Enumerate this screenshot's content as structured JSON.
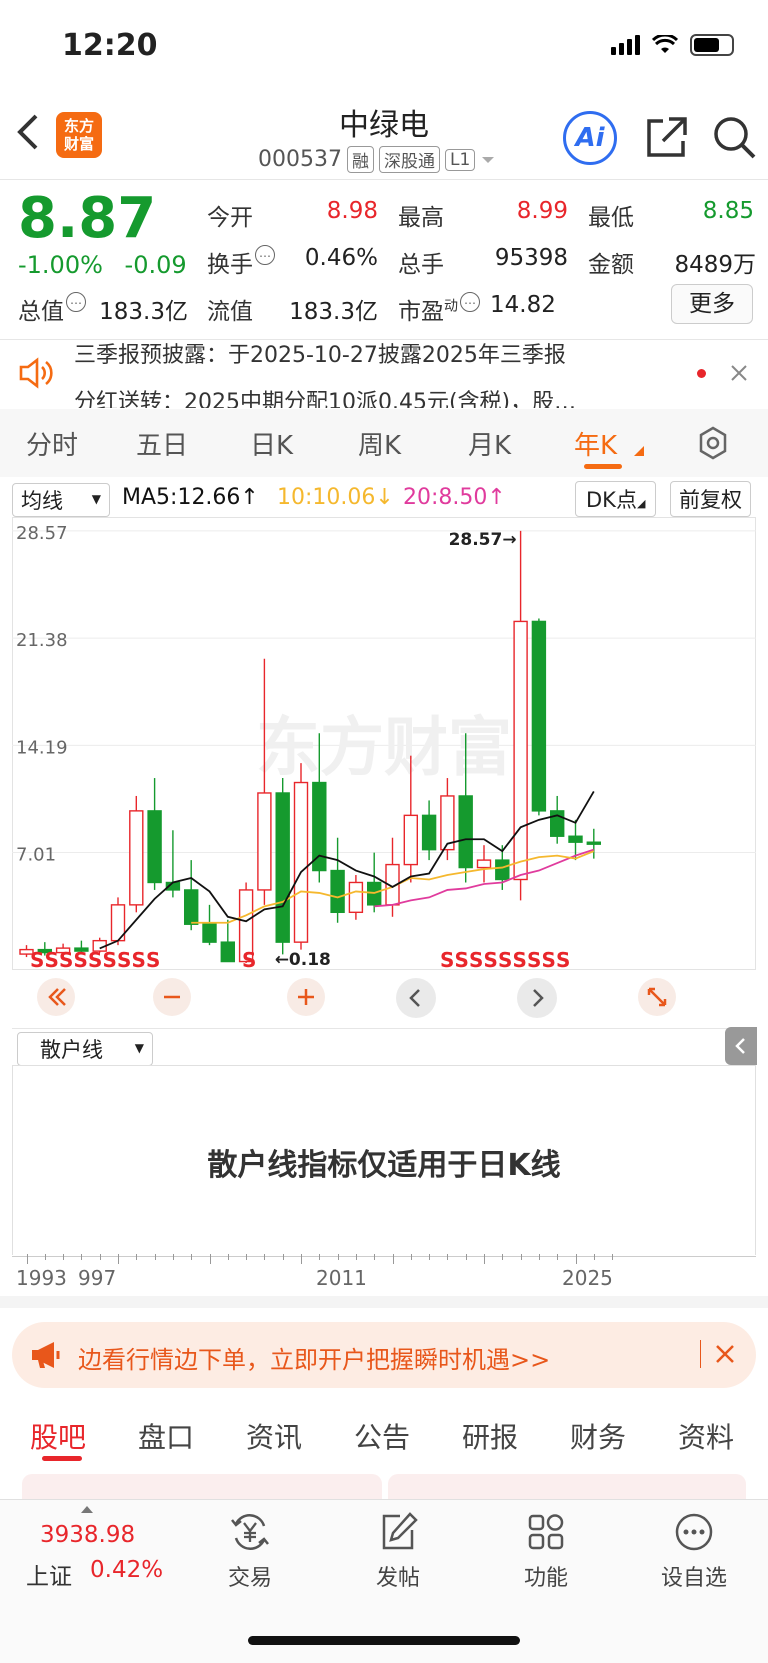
{
  "status_bar": {
    "time": "12:20"
  },
  "header": {
    "logo_text_1": "东方",
    "logo_text_2": "财富",
    "stock_name": "中绿电",
    "stock_code": "000537",
    "tags": [
      "融",
      "深股通",
      "L1"
    ],
    "ai_label": "Ai"
  },
  "quote": {
    "price": "8.87",
    "change_pct": "-1.00%",
    "change_abs": "-0.09",
    "open_label": "今开",
    "open": "8.98",
    "high_label": "最高",
    "high": "8.99",
    "low_label": "最低",
    "low": "8.85",
    "turnover_label": "换手",
    "turnover": "0.46%",
    "volume_label": "总手",
    "volume": "95398",
    "amount_label": "金额",
    "amount": "8489万",
    "mktcap_label": "总值",
    "mktcap": "183.3亿",
    "float_label": "流值",
    "float": "183.3亿",
    "pe_label": "市盈",
    "pe_sup": "动",
    "pe": "14.82",
    "more_label": "更多"
  },
  "notice": {
    "line1": "三季报预披露：于2025-10-27披露2025年三季报",
    "line2": "分红送转：2025中期分配10派0.45元(含税)，股…"
  },
  "kline_tabs": [
    "分时",
    "五日",
    "日K",
    "周K",
    "月K",
    "年K"
  ],
  "chart_toolbar": {
    "indicator": "均线",
    "ma5": "MA5:12.66",
    "ma10": "10:10.06",
    "ma20": "20:8.50",
    "dk": "DK点",
    "adjust": "前复权"
  },
  "chart_data": {
    "type": "candlestick",
    "y_ticks": [
      "28.57",
      "21.38",
      "14.19",
      "7.01"
    ],
    "y_tick_values": [
      28.57,
      21.38,
      14.19,
      7.01
    ],
    "ylim": [
      -0.8,
      29.5
    ],
    "max_label": "28.57→",
    "min_label": "←0.18",
    "x_labels": [
      "1993",
      "997",
      "2011",
      "2025"
    ],
    "watermark": "东方财富",
    "candles": [
      {
        "o": 0.2,
        "h": 0.8,
        "l": 0.0,
        "c": 0.5
      },
      {
        "o": 0.5,
        "h": 1.0,
        "l": 0.1,
        "c": 0.3
      },
      {
        "o": 0.3,
        "h": 0.9,
        "l": 0.0,
        "c": 0.6
      },
      {
        "o": 0.6,
        "h": 1.1,
        "l": 0.2,
        "c": 0.4
      },
      {
        "o": 0.4,
        "h": 1.3,
        "l": 0.3,
        "c": 1.1
      },
      {
        "o": 1.1,
        "h": 4.0,
        "l": 0.8,
        "c": 3.5
      },
      {
        "o": 3.5,
        "h": 10.8,
        "l": 3.0,
        "c": 9.8
      },
      {
        "o": 9.8,
        "h": 12.0,
        "l": 4.5,
        "c": 5.0
      },
      {
        "o": 5.0,
        "h": 8.5,
        "l": 4.0,
        "c": 4.5
      },
      {
        "o": 4.5,
        "h": 6.5,
        "l": 1.8,
        "c": 2.2
      },
      {
        "o": 2.2,
        "h": 3.5,
        "l": 0.8,
        "c": 1.0
      },
      {
        "o": 1.0,
        "h": 2.5,
        "l": 0.2,
        "c": -0.3
      },
      {
        "o": -0.3,
        "h": 5.0,
        "l": -0.4,
        "c": 4.5
      },
      {
        "o": 4.5,
        "h": 20.0,
        "l": 3.5,
        "c": 11.0
      },
      {
        "o": 11.0,
        "h": 12.0,
        "l": 0.18,
        "c": 1.0
      },
      {
        "o": 1.0,
        "h": 13.0,
        "l": 0.5,
        "c": 11.7
      },
      {
        "o": 11.7,
        "h": 15.0,
        "l": 5.0,
        "c": 5.8
      },
      {
        "o": 5.8,
        "h": 8.0,
        "l": 2.3,
        "c": 3.0
      },
      {
        "o": 3.0,
        "h": 5.5,
        "l": 2.5,
        "c": 5.0
      },
      {
        "o": 5.0,
        "h": 7.0,
        "l": 3.0,
        "c": 3.5
      },
      {
        "o": 3.5,
        "h": 8.0,
        "l": 2.7,
        "c": 6.2
      },
      {
        "o": 6.2,
        "h": 13.5,
        "l": 5.0,
        "c": 9.5
      },
      {
        "o": 9.5,
        "h": 10.5,
        "l": 6.5,
        "c": 7.2
      },
      {
        "o": 7.2,
        "h": 12.0,
        "l": 6.5,
        "c": 10.8
      },
      {
        "o": 10.8,
        "h": 15.0,
        "l": 5.0,
        "c": 6.0
      },
      {
        "o": 6.0,
        "h": 7.5,
        "l": 5.0,
        "c": 6.5
      },
      {
        "o": 6.5,
        "h": 7.5,
        "l": 4.5,
        "c": 5.2
      },
      {
        "o": 5.2,
        "h": 28.57,
        "l": 3.8,
        "c": 22.5
      },
      {
        "o": 22.5,
        "h": 22.7,
        "l": 9.5,
        "c": 9.8
      },
      {
        "o": 9.8,
        "h": 10.8,
        "l": 7.6,
        "c": 8.1
      },
      {
        "o": 8.1,
        "h": 9.2,
        "l": 6.5,
        "c": 7.7
      },
      {
        "o": 7.7,
        "h": 8.6,
        "l": 6.6,
        "c": 7.6
      }
    ],
    "ma5": [
      null,
      null,
      null,
      null,
      0.58,
      1.1,
      2.5,
      3.9,
      5.0,
      5.3,
      4.4,
      2.7,
      2.4,
      3.2,
      3.4,
      5.7,
      6.8,
      6.5,
      5.8,
      5.4,
      4.7,
      5.4,
      5.6,
      7.6,
      7.9,
      7.9,
      7.1,
      8.7,
      9.2,
      9.5,
      9.0,
      11.1
    ],
    "ma10": [
      null,
      null,
      null,
      null,
      null,
      null,
      null,
      null,
      null,
      2.3,
      2.3,
      2.3,
      2.8,
      3.4,
      3.7,
      4.4,
      4.3,
      4.0,
      4.4,
      4.3,
      4.7,
      5.3,
      5.2,
      5.5,
      5.7,
      5.9,
      6.0,
      6.4,
      6.7,
      6.8,
      6.6,
      7.1
    ],
    "ma20": [
      null,
      null,
      null,
      null,
      null,
      null,
      null,
      null,
      null,
      null,
      null,
      null,
      null,
      null,
      null,
      null,
      null,
      null,
      null,
      3.4,
      3.5,
      3.8,
      4.0,
      4.5,
      4.6,
      4.9,
      5.0,
      5.5,
      5.8,
      6.3,
      6.8,
      7.2
    ],
    "s_marks_left": "SSSSSSSSS",
    "s_mark_mid": "S",
    "s_marks_right": "SSSSSSSSS",
    "colors": {
      "up": "#e8262b",
      "down": "#159a2e",
      "ma5": "#111111",
      "ma10": "#f5b82e",
      "ma20": "#e03b9d"
    }
  },
  "sub_indicator": {
    "select": "散户线",
    "message": "散户线指标仅适用于日K线"
  },
  "promo": {
    "text": "边看行情边下单，立即开户把握瞬时机遇>>"
  },
  "bottom_tabs": [
    "股吧",
    "盘口",
    "资讯",
    "公告",
    "研报",
    "财务",
    "资料"
  ],
  "bottom_nav": {
    "index_value": "3938.98",
    "index_name": "上证",
    "index_change": "0.42%",
    "items": [
      "交易",
      "发帖",
      "功能",
      "设自选"
    ]
  }
}
